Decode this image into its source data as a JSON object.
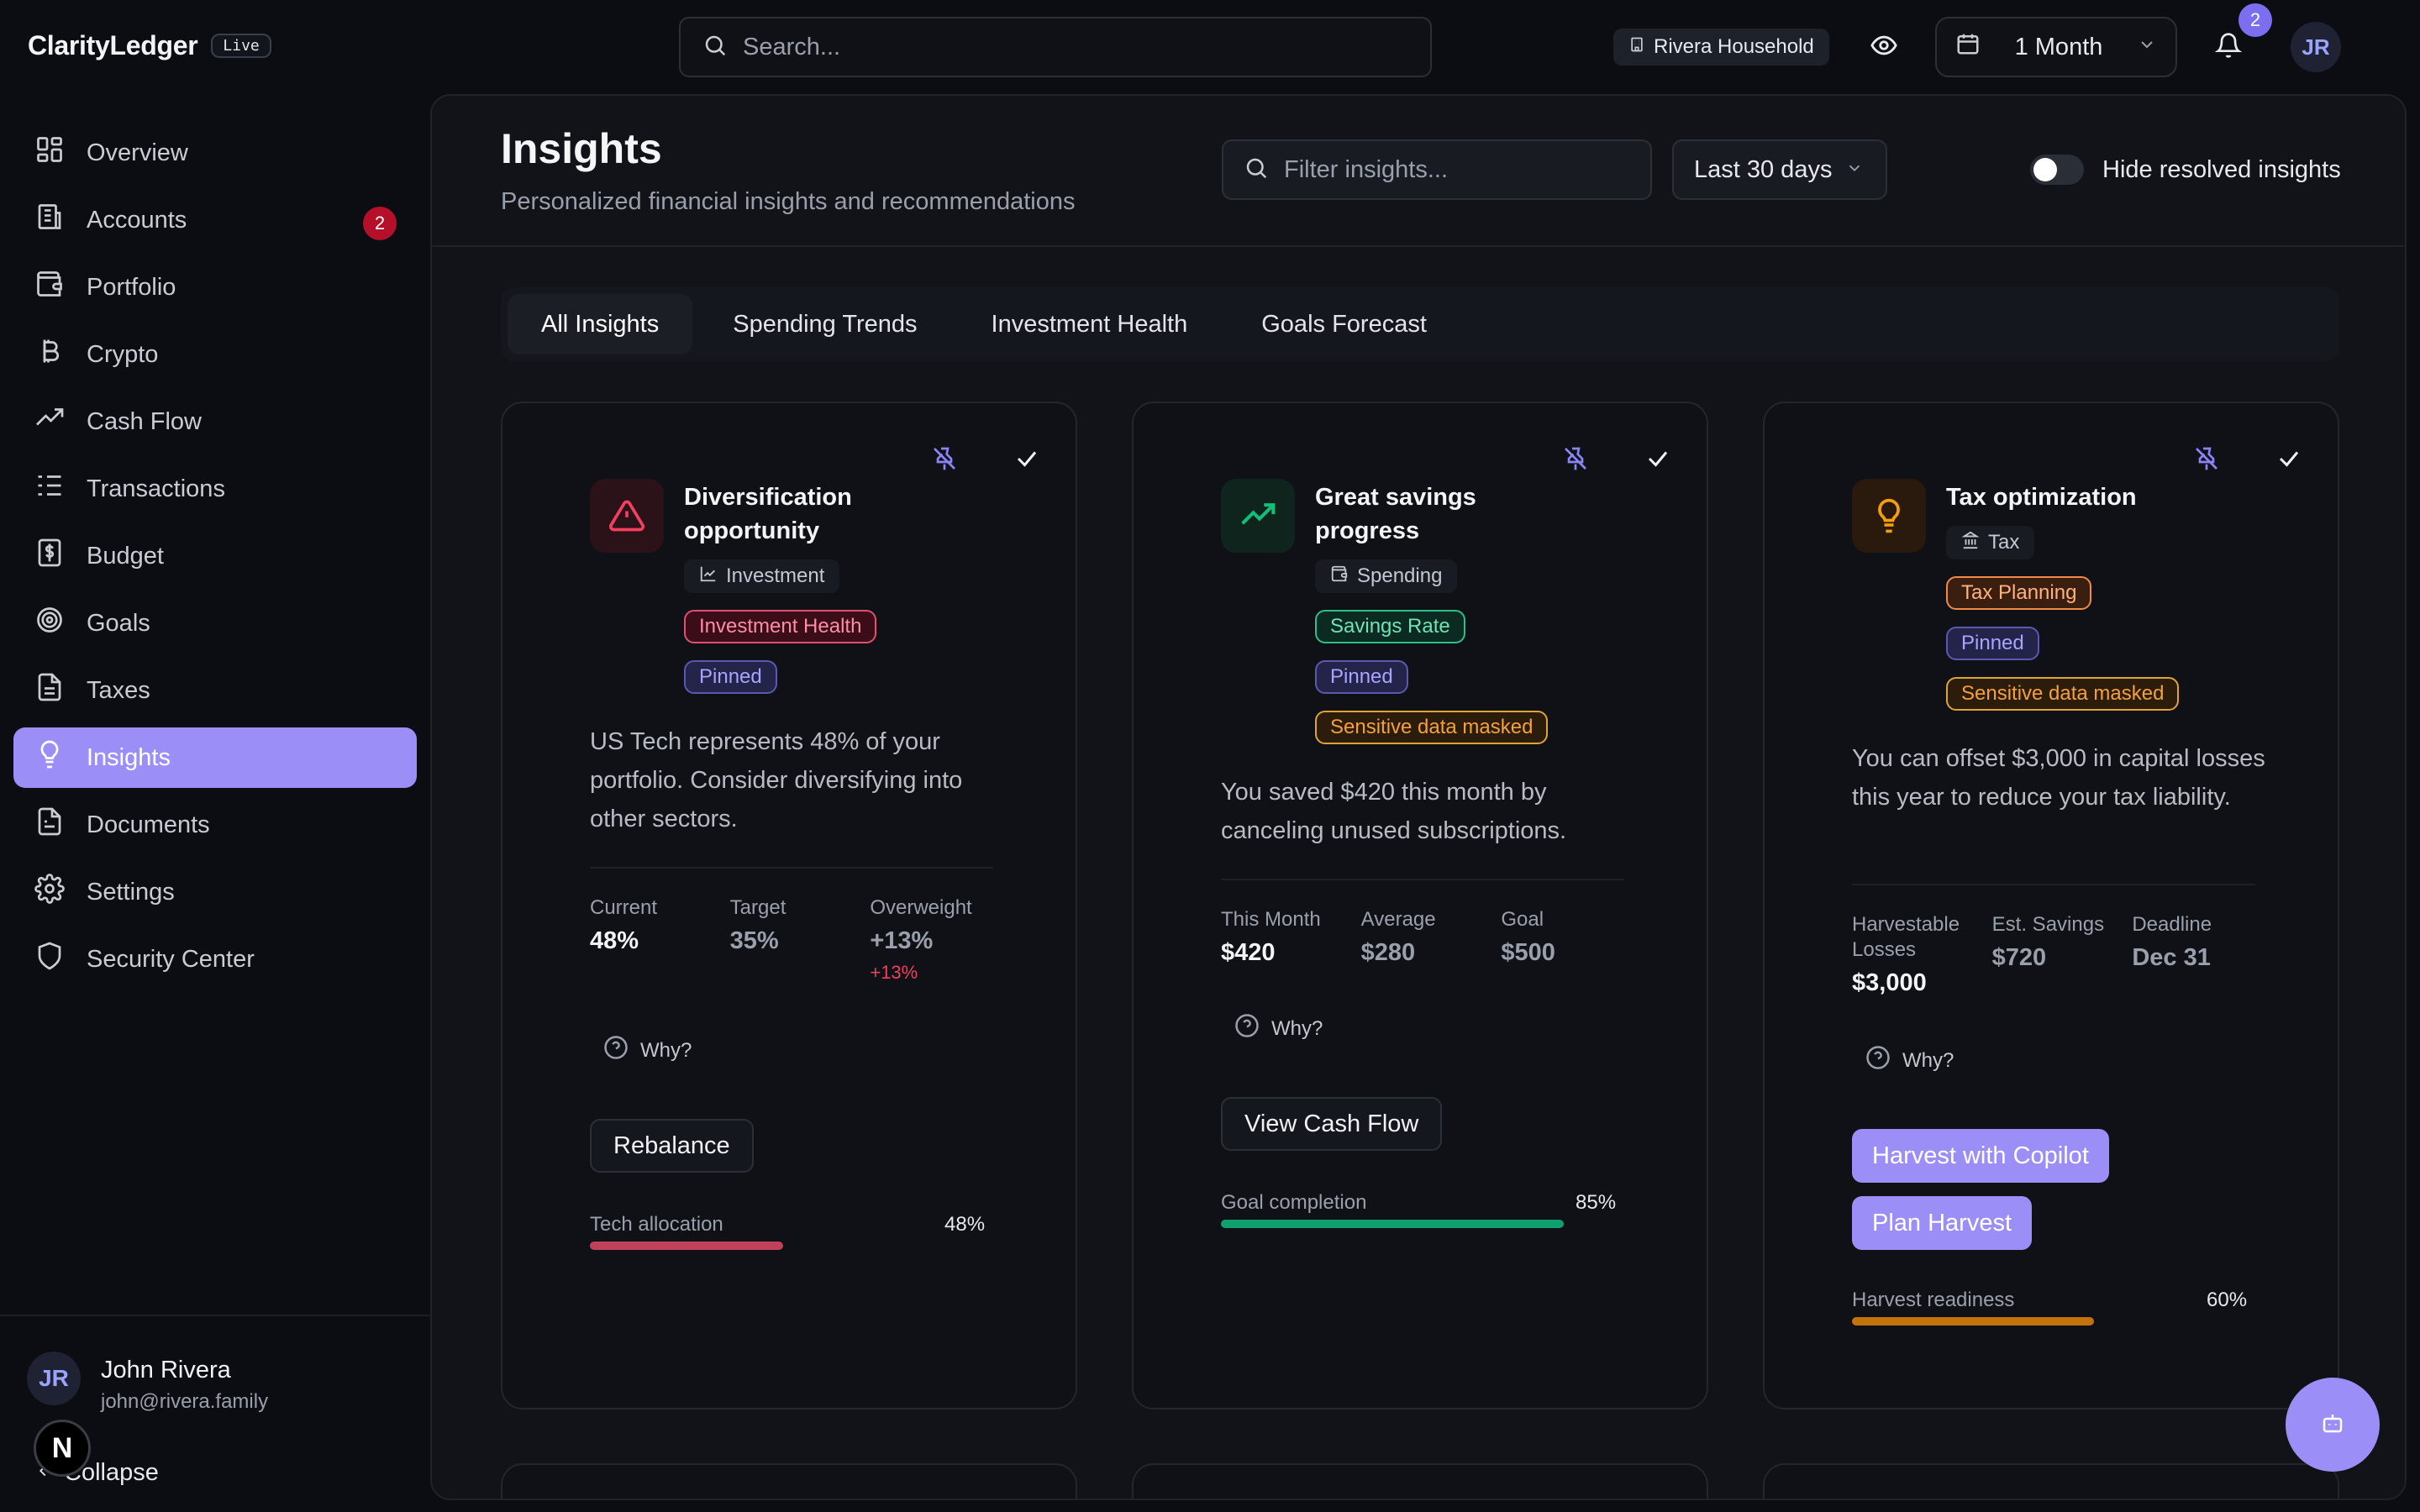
{
  "app": {
    "brand": "ClarityLedger",
    "live_badge": "Live"
  },
  "topbar": {
    "search_placeholder": "Search...",
    "household": "Rivera Household",
    "period": "1 Month",
    "notifications_count": "2",
    "avatar_initials": "JR"
  },
  "sidebar": {
    "items": [
      {
        "label": "Overview",
        "icon": "grid-icon"
      },
      {
        "label": "Accounts",
        "icon": "bank-icon",
        "badge": "2"
      },
      {
        "label": "Portfolio",
        "icon": "wallet-icon"
      },
      {
        "label": "Crypto",
        "icon": "bitcoin-icon"
      },
      {
        "label": "Cash Flow",
        "icon": "trending-up-icon"
      },
      {
        "label": "Transactions",
        "icon": "list-icon"
      },
      {
        "label": "Budget",
        "icon": "dollar-receipt-icon"
      },
      {
        "label": "Goals",
        "icon": "target-icon"
      },
      {
        "label": "Taxes",
        "icon": "document-icon"
      },
      {
        "label": "Insights",
        "icon": "lightbulb-icon",
        "active": true
      },
      {
        "label": "Documents",
        "icon": "file-icon"
      },
      {
        "label": "Settings",
        "icon": "gear-icon"
      },
      {
        "label": "Security Center",
        "icon": "shield-icon"
      }
    ],
    "user": {
      "initials": "JR",
      "name": "John Rivera",
      "email": "john@rivera.family"
    },
    "collapse_label": "Collapse",
    "n_logo": "N"
  },
  "main": {
    "title": "Insights",
    "subtitle": "Personalized financial insights and recommendations",
    "filter_placeholder": "Filter insights...",
    "range": "Last 30 days",
    "hide_resolved_label": "Hide resolved insights",
    "tabs": [
      {
        "label": "All Insights",
        "active": true
      },
      {
        "label": "Spending Trends"
      },
      {
        "label": "Investment Health"
      },
      {
        "label": "Goals Forecast"
      }
    ]
  },
  "cards": [
    {
      "title_line1": "Diversification",
      "title_line2": "opportunity",
      "category": "Investment",
      "pills": [
        "Investment Health",
        "Pinned"
      ],
      "description": "US Tech represents 48% of your portfolio. Consider diversifying into other sectors.",
      "metrics": [
        {
          "label": "Current",
          "value": "48%"
        },
        {
          "label": "Target",
          "value": "35%"
        },
        {
          "label": "Overweight",
          "value": "+13%",
          "delta": "+13%"
        }
      ],
      "why": "Why?",
      "action": "Rebalance",
      "progress_label": "Tech allocation",
      "progress_pct": "48%",
      "progress_value": 0.48,
      "progress_color": "#c2415a"
    },
    {
      "title_line1": "Great savings",
      "title_line2": "progress",
      "category": "Spending",
      "pills": [
        "Savings Rate",
        "Pinned",
        "Sensitive data masked"
      ],
      "description": "You saved $420 this month by canceling unused subscriptions.",
      "metrics": [
        {
          "label": "This Month",
          "value": "$420"
        },
        {
          "label": "Average",
          "value": "$280"
        },
        {
          "label": "Goal",
          "value": "$500"
        }
      ],
      "why": "Why?",
      "action": "View Cash Flow",
      "progress_label": "Goal completion",
      "progress_pct": "85%",
      "progress_value": 0.85,
      "progress_color": "#10a070"
    },
    {
      "title": "Tax optimization",
      "category": "Tax",
      "pills": [
        "Tax Planning",
        "Pinned",
        "Sensitive data masked"
      ],
      "description": "You can offset $3,000 in capital losses this year to reduce your tax liability.",
      "metrics": [
        {
          "label_line1": "Harvestable",
          "label_line2": "Losses",
          "value": "$3,000"
        },
        {
          "label": "Est. Savings",
          "value": "$720"
        },
        {
          "label": "Deadline",
          "value": "Dec 31"
        }
      ],
      "why": "Why?",
      "actions": [
        "Harvest with Copilot",
        "Plan Harvest"
      ],
      "progress_label": "Harvest readiness",
      "progress_pct": "60%",
      "progress_value": 0.6,
      "progress_color": "#c2730a"
    }
  ],
  "colors": {
    "accent": "#9b8ff7",
    "danger": "#f43f5e",
    "success": "#10a070",
    "warning": "#c2730a"
  }
}
